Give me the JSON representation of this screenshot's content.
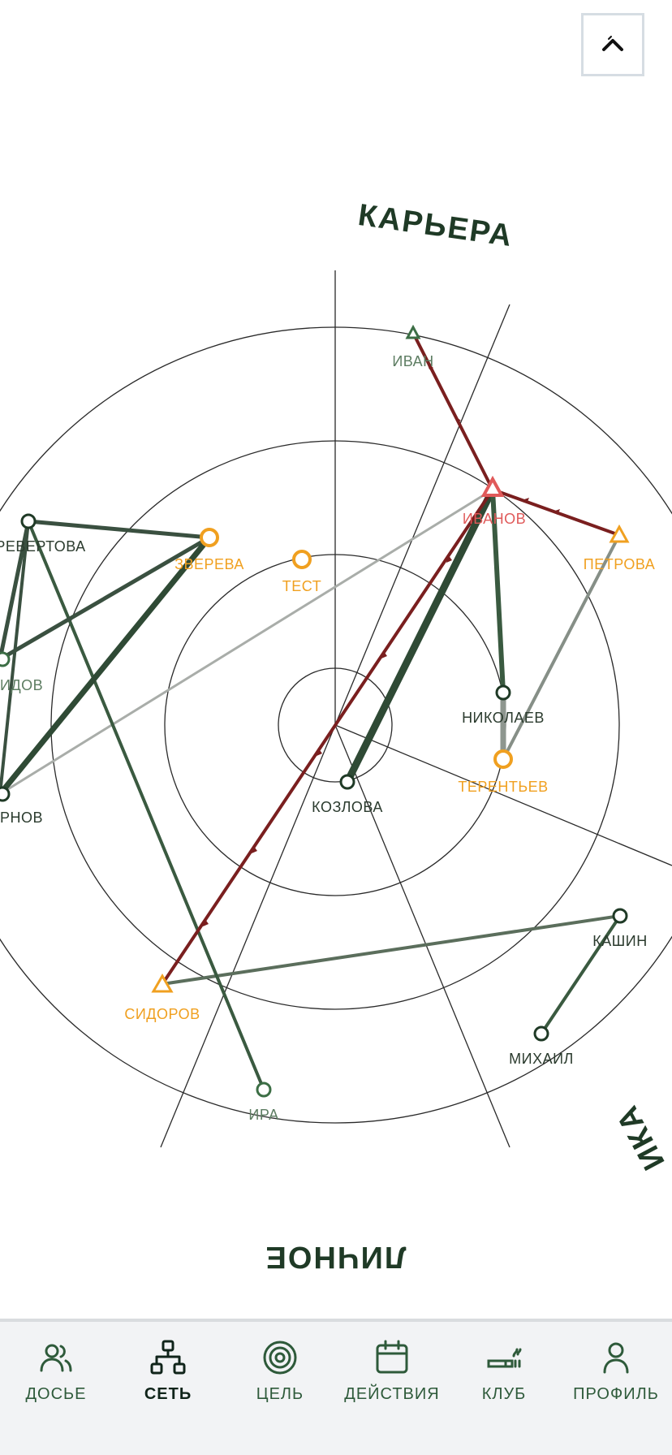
{
  "sectors": {
    "career": "КАРЬЕРА",
    "personal": "ЛИЧНОЕ",
    "right_partial": "ИКА"
  },
  "network": {
    "nodes": [
      {
        "id": "ivan",
        "label": "ИВАН",
        "shape": "triangle",
        "color": "#3c6e45",
        "label_color": "#5d7d62"
      },
      {
        "id": "ivanov",
        "label": "ИВАНОВ",
        "shape": "triangle",
        "color": "#e05a5a",
        "label_color": "#e05a5a"
      },
      {
        "id": "petrova",
        "label": "ПЕТРОВА",
        "shape": "triangle",
        "color": "#f0a020",
        "label_color": "#f0a020"
      },
      {
        "id": "zvereva",
        "label": "ЗВЕРЕВА",
        "shape": "circle",
        "color": "#f0a020",
        "label_color": "#f0a020"
      },
      {
        "id": "test",
        "label": "ТЕСТ",
        "shape": "circle",
        "color": "#f0a020",
        "label_color": "#f0a020"
      },
      {
        "id": "nikolaev",
        "label": "НИКОЛАЕВ",
        "shape": "circle",
        "color": "#1f3a26",
        "label_color": "#2b3b2e"
      },
      {
        "id": "terentev",
        "label": "ТЕРЕНТЬЕВ",
        "shape": "circle",
        "color": "#f0a020",
        "label_color": "#f0a020"
      },
      {
        "id": "kozlova",
        "label": "КОЗЛОВА",
        "shape": "circle",
        "color": "#1f3a26",
        "label_color": "#2b3b2e"
      },
      {
        "id": "sidorov",
        "label": "СИДОРОВ",
        "shape": "triangle",
        "color": "#f0a020",
        "label_color": "#f0a020"
      },
      {
        "id": "kashin",
        "label": "КАШИН",
        "shape": "circle",
        "color": "#1f3a26",
        "label_color": "#2b3b2e"
      },
      {
        "id": "mikhail",
        "label": "МИХАИЛ",
        "shape": "circle",
        "color": "#1f3a26",
        "label_color": "#2b3b2e"
      },
      {
        "id": "ira",
        "label": "ИРА",
        "shape": "circle",
        "color": "#3c6e45",
        "label_color": "#5d7d62"
      },
      {
        "id": "perevertova",
        "label": "РЕВЕРТОВА",
        "shape": "circle",
        "color": "#1f3a26",
        "label_color": "#2b3b2e"
      },
      {
        "id": "sidov",
        "label": "ИДОВ",
        "shape": "circle",
        "color": "#3c6e45",
        "label_color": "#5d7d62"
      },
      {
        "id": "rnov",
        "label": "РНОВ",
        "shape": "circle",
        "color": "#1f3a26",
        "label_color": "#2b3b2e"
      }
    ]
  },
  "colors": {
    "primary": "#1f3a26",
    "accent_orange": "#f0a020",
    "accent_red": "#e05a5a",
    "link_red": "#7a1f1f"
  },
  "close_button": {
    "icon": "chevron-up-icon"
  },
  "tabs": [
    {
      "label": "ДОСЬЕ",
      "icon": "users-icon"
    },
    {
      "label": "СЕТЬ",
      "icon": "network-icon",
      "active": true
    },
    {
      "label": "ЦЕЛЬ",
      "icon": "target-icon"
    },
    {
      "label": "ДЕЙСТВИЯ",
      "icon": "calendar-icon"
    },
    {
      "label": "КЛУБ",
      "icon": "cigar-icon"
    },
    {
      "label": "ПРОФИЛЬ",
      "icon": "user-icon"
    }
  ]
}
